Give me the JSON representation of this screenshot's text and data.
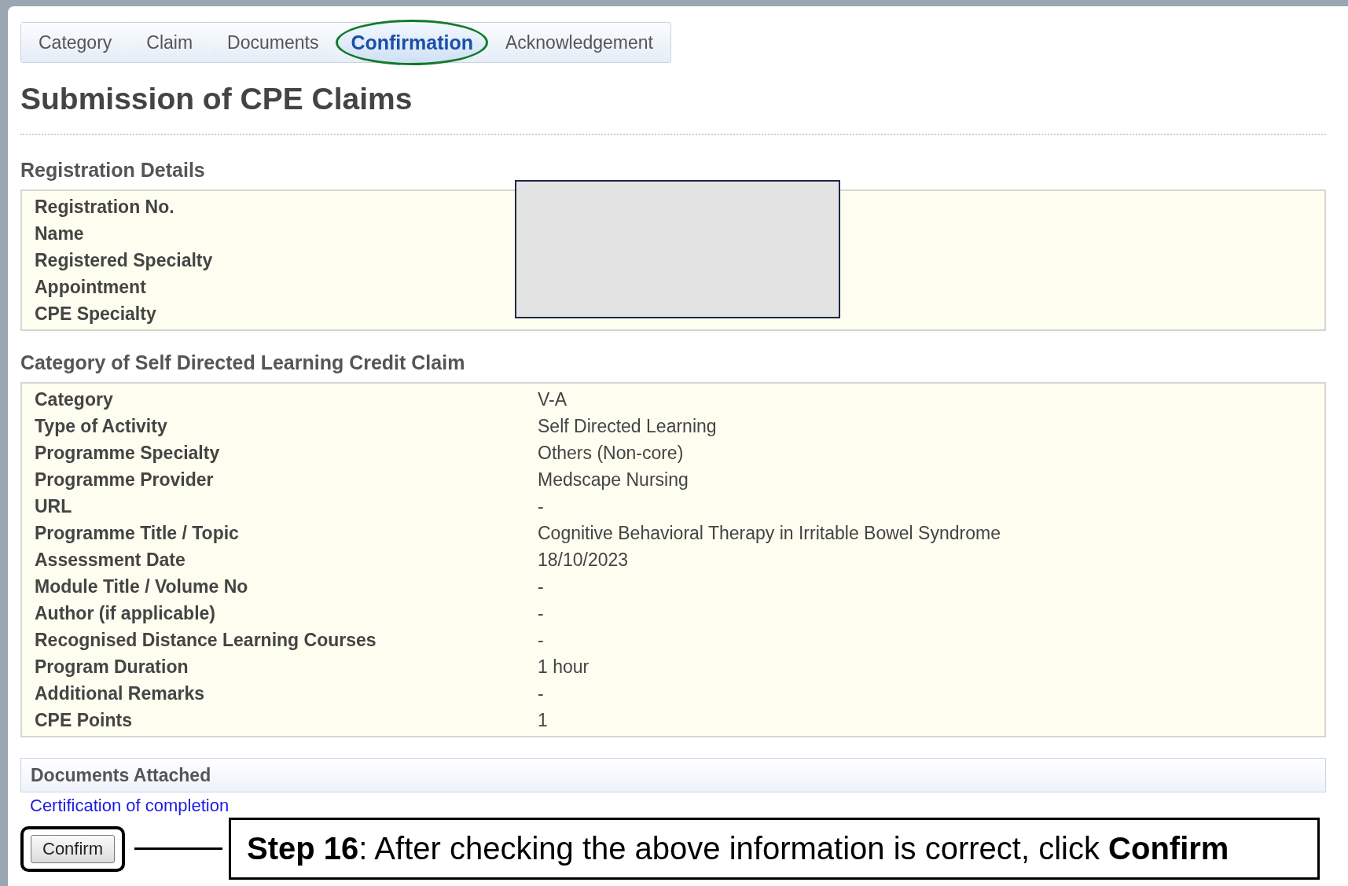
{
  "breadcrumb": [
    {
      "label": "Category",
      "selected": false
    },
    {
      "label": "Claim",
      "selected": false
    },
    {
      "label": "Documents",
      "selected": false
    },
    {
      "label": "Confirmation",
      "selected": true
    },
    {
      "label": "Acknowledgement",
      "selected": false
    }
  ],
  "title": "Submission of CPE Claims",
  "registration": {
    "heading": "Registration Details",
    "fields": [
      {
        "label": "Registration No."
      },
      {
        "label": "Name"
      },
      {
        "label": "Registered Specialty"
      },
      {
        "label": "Appointment"
      },
      {
        "label": "CPE Specialty"
      }
    ]
  },
  "claim": {
    "heading": "Category of Self Directed Learning Credit Claim",
    "fields": [
      {
        "label": "Category",
        "value": "V-A"
      },
      {
        "label": "Type of Activity",
        "value": "Self Directed Learning"
      },
      {
        "label": "Programme Specialty",
        "value": "Others (Non-core)"
      },
      {
        "label": "Programme Provider",
        "value": "Medscape Nursing"
      },
      {
        "label": "URL",
        "value": "-"
      },
      {
        "label": "Programme Title / Topic",
        "value": "Cognitive Behavioral Therapy in Irritable Bowel Syndrome"
      },
      {
        "label": "Assessment Date",
        "value": "18/10/2023"
      },
      {
        "label": "Module Title / Volume No",
        "value": "-"
      },
      {
        "label": "Author (if applicable)",
        "value": "-"
      },
      {
        "label": "Recognised Distance Learning Courses",
        "value": "-"
      },
      {
        "label": "Program Duration",
        "value": "1 hour"
      },
      {
        "label": "Additional Remarks",
        "value": "-"
      },
      {
        "label": "CPE Points",
        "value": "1"
      }
    ]
  },
  "documents": {
    "heading": "Documents Attached",
    "links": [
      "Certification of completion"
    ]
  },
  "confirm_button": "Confirm",
  "callout": "**Step 16**: After checking the above information is correct, click **Confirm**"
}
